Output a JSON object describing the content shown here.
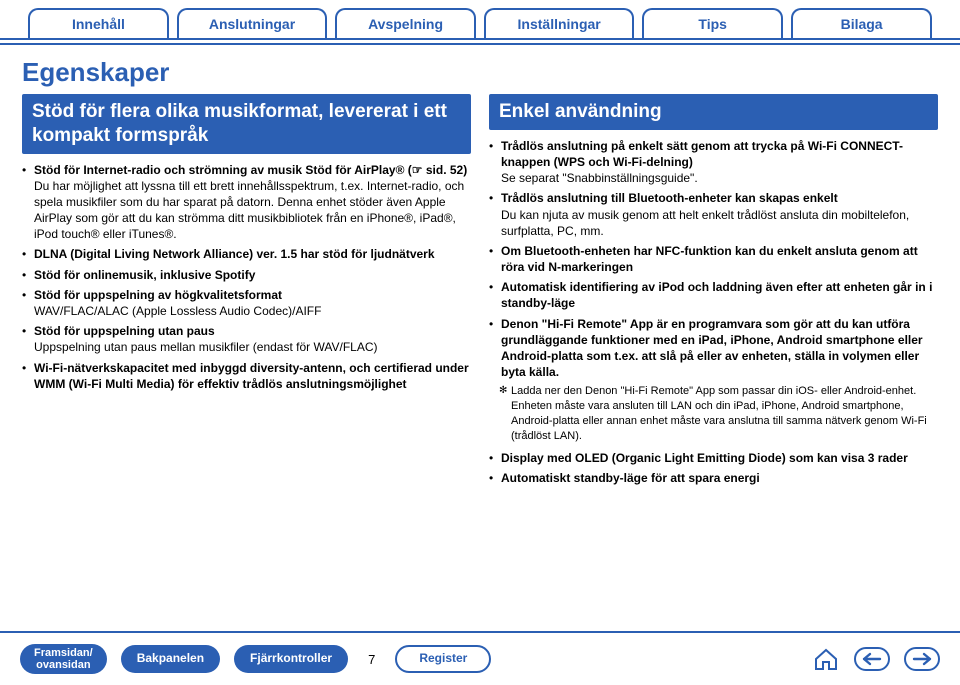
{
  "nav": {
    "tabs": [
      "Innehåll",
      "Anslutningar",
      "Avspelning",
      "Inställningar",
      "Tips",
      "Bilaga"
    ]
  },
  "page_title": "Egenskaper",
  "left": {
    "heading": "Stöd för flera olika musikformat, levererat i ett kompakt formspråk",
    "items": [
      {
        "lead": "Stöd för Internet-radio och strömning av musik Stöd för AirPlay® (☞ sid. 52)",
        "sub": "Du har möjlighet att lyssna till ett brett innehållsspektrum, t.ex. Internet-radio, och spela musikfiler som du har sparat på datorn.\nDenna enhet stöder även Apple AirPlay som gör att du kan strömma ditt musikbibliotek från en iPhone®, iPad®, iPod touch® eller iTunes®."
      },
      {
        "lead": "DLNA (Digital Living Network Alliance) ver. 1.5 har stöd för ljudnätverk"
      },
      {
        "lead": "Stöd för onlinemusik, inklusive Spotify"
      },
      {
        "lead": "Stöd för uppspelning av högkvalitetsformat",
        "sub": "WAV/FLAC/ALAC (Apple Lossless Audio Codec)/AIFF"
      },
      {
        "lead": "Stöd för uppspelning utan paus",
        "sub": "Uppspelning utan paus mellan musikfiler (endast för WAV/FLAC)"
      },
      {
        "lead": "Wi-Fi-nätverkskapacitet med inbyggd diversity-antenn, och certifierad under WMM (Wi-Fi Multi Media) för effektiv trådlös anslutningsmöjlighet"
      }
    ]
  },
  "right": {
    "heading": "Enkel användning",
    "items": [
      {
        "lead": "Trådlös anslutning på enkelt sätt genom att trycka på Wi-Fi CONNECT-knappen (WPS och Wi-Fi-delning)",
        "sub": "Se separat \"Snabbinställningsguide\"."
      },
      {
        "lead": "Trådlös anslutning till Bluetooth-enheter kan skapas enkelt",
        "sub": "Du kan njuta av musik genom att helt enkelt trådlöst ansluta din mobiltelefon, surfplatta, PC, mm."
      },
      {
        "lead": "Om Bluetooth-enheten har NFC-funktion kan du enkelt ansluta genom att röra vid N-markeringen"
      },
      {
        "lead": "Automatisk identifiering av iPod och laddning även efter att enheten går in i standby-läge"
      },
      {
        "lead": "Denon \"Hi-Fi Remote\" App är en programvara som gör att du kan utföra grundläggande funktioner med en iPad, iPhone, Android smartphone eller Android-platta som t.ex. att slå på eller av enheten, ställa in volymen eller byta källa.",
        "note": "Ladda ner den Denon \"Hi-Fi Remote\" App som passar din iOS- eller Android-enhet. Enheten måste vara ansluten till LAN och din iPad, iPhone, Android smartphone, Android-platta eller annan enhet måste vara anslutna till samma nätverk genom Wi-Fi (trådlöst LAN)."
      },
      {
        "lead": "Display med OLED (Organic Light Emitting Diode) som kan visa 3 rader"
      },
      {
        "lead": "Automatiskt standby-läge för att spara energi"
      }
    ]
  },
  "footer": {
    "btn_front": "Framsidan/\novansidan",
    "btn_back": "Bakpanelen",
    "btn_remote": "Fjärrkontroller",
    "page_number": "7",
    "btn_index": "Register"
  }
}
